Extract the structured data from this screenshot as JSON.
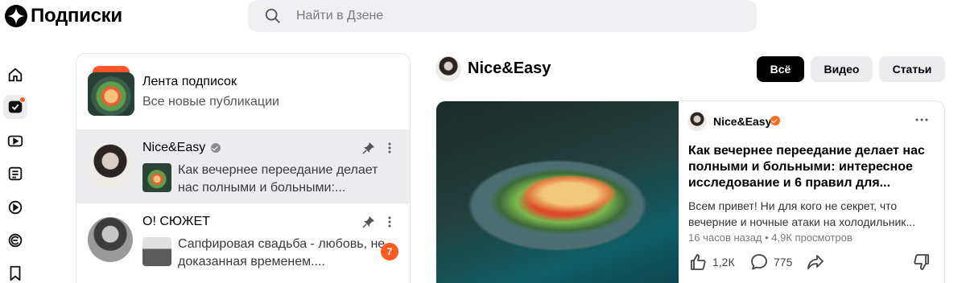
{
  "header": {
    "logo_text": "Подписки",
    "search_placeholder": "Найти в Дзене"
  },
  "rail": {
    "items": [
      {
        "name": "home"
      },
      {
        "name": "subscriptions",
        "active": true,
        "has_dot": true
      },
      {
        "name": "video"
      },
      {
        "name": "articles"
      },
      {
        "name": "shorts"
      },
      {
        "name": "channel"
      },
      {
        "name": "saved"
      }
    ]
  },
  "subscriptions": {
    "feed": {
      "title": "Лента подписок",
      "subtitle": "Все новые публикации"
    },
    "items": [
      {
        "name": "Nice&Easy",
        "verified": true,
        "pinned": true,
        "preview": "Как вечернее переедание делает нас полными и больными:...",
        "selected": true
      },
      {
        "name": "О! СЮЖЕТ",
        "pinned": true,
        "preview": "Сапфировая свадьба - любовь, не доказанная временем....",
        "unread": "7"
      }
    ]
  },
  "channel": {
    "title": "Nice&Easy",
    "filters": [
      "Всё",
      "Видео",
      "Статьи"
    ],
    "active_filter": "Всё"
  },
  "post": {
    "channel": "Nice&Easy",
    "verified_color": "#ff6a1a",
    "title": "Как вечернее переедание делает нас полными и больными: интересное исследование и 6 правил для...",
    "snippet": "Всем привет! Ни для кого не секрет, что вечерние и ночные атаки на холодильник...",
    "meta": "16 часов назад • 4,9К просмотров",
    "likes": "1,2К",
    "comments": "775"
  },
  "colors": {
    "accent": "#ff5a1f",
    "selected_bg": "#ececef"
  }
}
